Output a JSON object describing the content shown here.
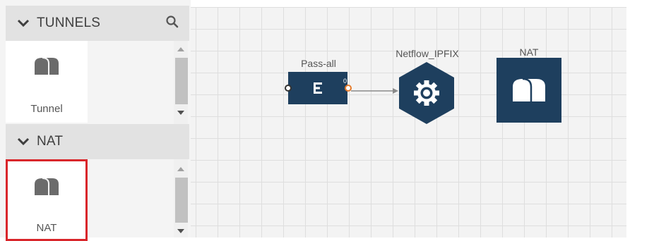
{
  "sidebar": {
    "sections": [
      {
        "title": "TUNNELS",
        "item": {
          "label": "Tunnel"
        }
      },
      {
        "title": "NAT",
        "item": {
          "label": "NAT"
        }
      }
    ]
  },
  "canvas": {
    "nodes": {
      "filter": {
        "label": "Pass-all",
        "icon": "filter-icon",
        "output_port": "0"
      },
      "app": {
        "label": "Netflow_IPFIX",
        "icon": "gear-icon"
      },
      "nat": {
        "label": "NAT",
        "icon": "tunnel-icon"
      }
    }
  },
  "colors": {
    "node_fill": "#1e3f5e",
    "selection_border": "#d9262b",
    "output_port": "#e57b2c"
  }
}
